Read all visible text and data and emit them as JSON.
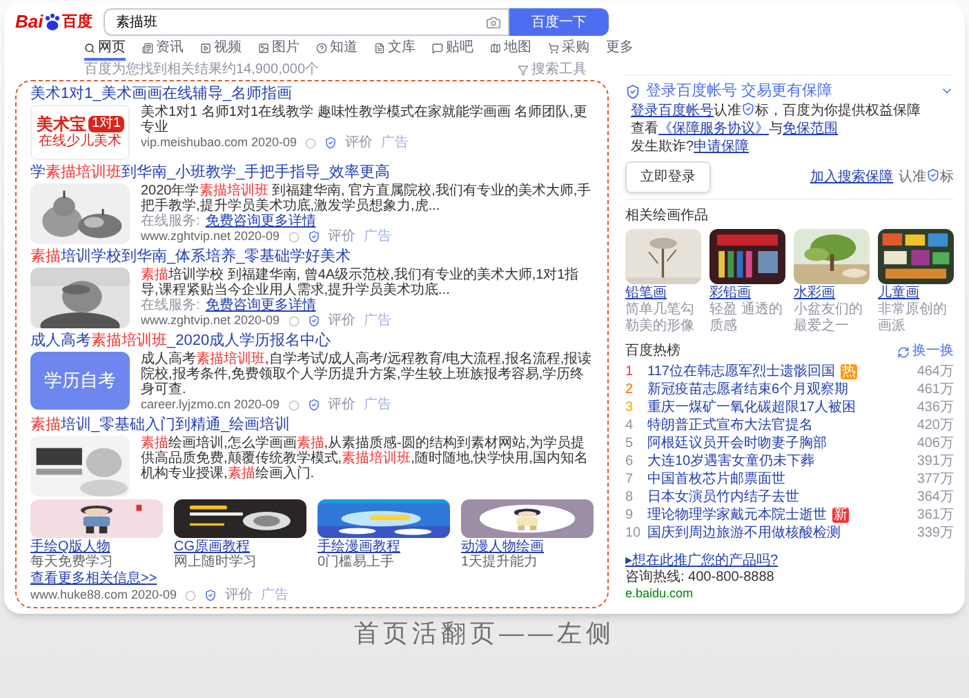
{
  "logo": {
    "prefix": "Bai",
    "suffix": "百度"
  },
  "search": {
    "value": "素描班",
    "button": "百度一下"
  },
  "tabs": [
    {
      "label": "网页",
      "selected": true
    },
    {
      "label": "资讯",
      "selected": false
    },
    {
      "label": "视频",
      "selected": false
    },
    {
      "label": "图片",
      "selected": false
    },
    {
      "label": "知道",
      "selected": false
    },
    {
      "label": "文库",
      "selected": false
    },
    {
      "label": "贴吧",
      "selected": false
    },
    {
      "label": "地图",
      "selected": false
    },
    {
      "label": "采购",
      "selected": false
    },
    {
      "label": "更多",
      "selected": false
    }
  ],
  "result_count": "百度为您找到相关结果约14,900,000个",
  "search_tools": "搜索工具",
  "results": [
    {
      "title": [
        {
          "text": "美术1对1_美术画画在线辅导_名师指画",
          "highlight": false
        }
      ],
      "thumb": {
        "kind": "logo",
        "lines": [
          "美术宝",
          "1对1",
          "在线少儿美术"
        ]
      },
      "description": [
        {
          "text": "美术1对1 名师1对1在线教学 趣味性教学模式在家就能学画画 名师团队,更专业",
          "highlight": false
        }
      ],
      "url": "vip.meishubao.com 2020-09",
      "review": "评价",
      "ad": "广告"
    },
    {
      "title": [
        {
          "text": "学",
          "highlight": false
        },
        {
          "text": "素描培训班",
          "highlight": true
        },
        {
          "text": "到华南_小班教学_手把手指导_效率更高",
          "highlight": false
        }
      ],
      "thumb": {
        "kind": "picture"
      },
      "description": [
        {
          "text": "2020年学",
          "highlight": false
        },
        {
          "text": "素描培训班",
          "highlight": true
        },
        {
          "text": " 到福建华南, 官方直属院校,我们有专业的美术大师,手把手教学,提升学员美术功底,激发学员想象力,虎...",
          "highlight": false
        }
      ],
      "service": {
        "label": "在线服务:",
        "link": "免费咨询更多详情"
      },
      "url": "www.zghtvip.net 2020-09",
      "review": "评价",
      "ad": "广告"
    },
    {
      "title": [
        {
          "text": "素描",
          "highlight": true
        },
        {
          "text": "培训学校到华南_体系培养_零基础学好美术",
          "highlight": false
        }
      ],
      "thumb": {
        "kind": "picture"
      },
      "description": [
        {
          "text": "素描",
          "highlight": true
        },
        {
          "text": "培训学校 到福建华南, 曾4A级示范校,我们有专业的美术大师,1对1指导,课程紧贴当今企业用人需求,提升学员美术功底...",
          "highlight": false
        }
      ],
      "service": {
        "label": "在线服务:",
        "link": "免费咨询更多详情"
      },
      "url": "www.zghtvip.net 2020-09",
      "review": "评价",
      "ad": "广告"
    },
    {
      "title": [
        {
          "text": "成人高考",
          "highlight": false
        },
        {
          "text": "素描培训班",
          "highlight": true
        },
        {
          "text": "_2020成人学历报名中心",
          "highlight": false
        }
      ],
      "thumb": {
        "kind": "label",
        "text": "学历自考"
      },
      "description": [
        {
          "text": "成人高考",
          "highlight": false
        },
        {
          "text": "素描培训班",
          "highlight": true
        },
        {
          "text": ",自学考试/成人高考/远程教育/电大流程,报名流程,报读院校,报考条件,免费领取个人学历提升方案,学生较上班族报考容易,学历终身可查.",
          "highlight": false
        }
      ],
      "url": "career.lyjzmo.cn 2020-09",
      "review": "评价",
      "ad": "广告"
    },
    {
      "title": [
        {
          "text": "素描",
          "highlight": true
        },
        {
          "text": "培训_零基础入门到精通_绘画培训",
          "highlight": false
        }
      ],
      "thumb": {
        "kind": "picture"
      },
      "description": [
        {
          "text": "素描",
          "highlight": true
        },
        {
          "text": "绘画培训,怎么学画画",
          "highlight": false
        },
        {
          "text": "素描",
          "highlight": true
        },
        {
          "text": ",从素描质感-圆的结构到素材网站,为学员提供高品质免费,颠覆传统教学模式,",
          "highlight": false
        },
        {
          "text": "素描培训班",
          "highlight": true
        },
        {
          "text": ",随时随地,快学快用,国内知名机构专业授课,",
          "highlight": false
        },
        {
          "text": "素描",
          "highlight": true
        },
        {
          "text": "绘画入门.",
          "highlight": false
        }
      ],
      "tiles": [
        {
          "title": "手绘Q版人物",
          "caption": "每天免费学习"
        },
        {
          "title": "CG原画教程",
          "caption": "网上随时学习"
        },
        {
          "title": "手绘漫画教程",
          "caption": "0门槛易上手"
        },
        {
          "title": "动漫人物绘画",
          "caption": "1天提升能力"
        }
      ],
      "more": "查看更多相关信息>>",
      "url": "www.huke88.com 2020-09",
      "review": "评价",
      "ad": "广告"
    }
  ],
  "guarantee": {
    "title": "登录百度帐号 交易更有保障",
    "bullets": [
      [
        {
          "kind": "link",
          "text": "登录百度帐号"
        },
        {
          "kind": "text",
          "text": "认准"
        },
        {
          "kind": "icon"
        },
        {
          "kind": "text",
          "text": "标，百度为你提供权益保障"
        }
      ],
      [
        {
          "kind": "text",
          "text": "查看"
        },
        {
          "kind": "link",
          "text": "《保障服务协议》"
        },
        {
          "kind": "text",
          "text": "与"
        },
        {
          "kind": "link",
          "text": "免保范围"
        }
      ],
      [
        {
          "kind": "text",
          "text": "发生欺诈?"
        },
        {
          "kind": "link",
          "text": "申请保障"
        }
      ]
    ],
    "button": "立即登录",
    "join": "加入搜索保障",
    "badge_note": [
      {
        "kind": "text",
        "text": "认准"
      },
      {
        "kind": "icon"
      },
      {
        "kind": "text",
        "text": "标"
      }
    ]
  },
  "paintings": {
    "title": "相关绘画作品",
    "items": [
      {
        "title": "铅笔画",
        "caption": "简单几笔勾勒美的形像"
      },
      {
        "title": "彩铅画",
        "caption": "轻盈 通透的质感"
      },
      {
        "title": "水彩画",
        "caption": "小盆友们的最爱之一"
      },
      {
        "title": "儿童画",
        "caption": "非常原创的画派"
      }
    ]
  },
  "hot": {
    "title": "百度热榜",
    "refresh": "换一换",
    "items": [
      {
        "rank": "1",
        "text": "117位在韩志愿军烈士遗骸回国",
        "count": "464万",
        "badge": {
          "kind": "hot",
          "text": "热"
        }
      },
      {
        "rank": "2",
        "text": "新冠疫苗志愿者结束6个月观察期",
        "count": "461万"
      },
      {
        "rank": "3",
        "text": "重庆一煤矿一氧化碳超限17人被困",
        "count": "436万"
      },
      {
        "rank": "4",
        "text": "特朗普正式宣布大法官提名",
        "count": "420万"
      },
      {
        "rank": "5",
        "text": "阿根廷议员开会时吻妻子胸部",
        "count": "406万"
      },
      {
        "rank": "6",
        "text": "大连10岁遇害女童仍未下葬",
        "count": "391万"
      },
      {
        "rank": "7",
        "text": "中国首枚芯片邮票面世",
        "count": "377万"
      },
      {
        "rank": "8",
        "text": "日本女演员竹内结子去世",
        "count": "364万"
      },
      {
        "rank": "9",
        "text": "理论物理学家戴元本院士逝世",
        "count": "361万",
        "badge": {
          "kind": "new",
          "text": "新"
        }
      },
      {
        "rank": "10",
        "text": "国庆到周边旅游不用做核酸检测",
        "count": "339万"
      }
    ]
  },
  "promo": {
    "link": "▸想在此推广您的产品吗?",
    "phone": "咨询热线: 400-800-8888",
    "site": "e.baidu.com"
  },
  "caption": "首页活翻页——左侧"
}
